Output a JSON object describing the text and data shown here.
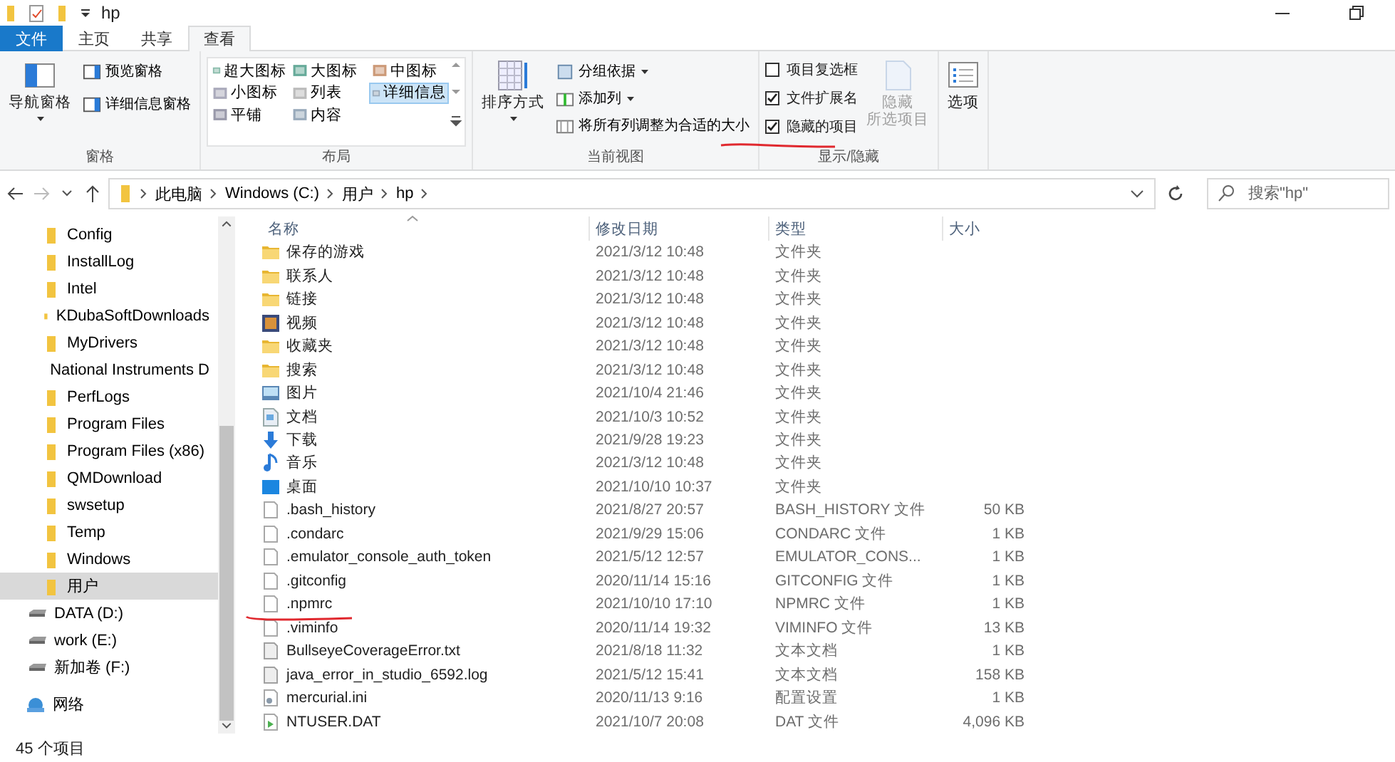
{
  "window": {
    "title": "hp"
  },
  "ribbon_tabs": [
    {
      "label": "文件",
      "kind": "file"
    },
    {
      "label": "主页",
      "kind": "tab",
      "selected": false
    },
    {
      "label": "共享",
      "kind": "tab",
      "selected": false
    },
    {
      "label": "查看",
      "kind": "tab",
      "selected": true
    }
  ],
  "ribbon": {
    "panes": {
      "label": "窗格",
      "navigation_pane": "导航窗格",
      "preview_pane": "预览窗格",
      "details_pane": "详细信息窗格"
    },
    "layout": {
      "label": "布局",
      "options": [
        {
          "label": "超大图标",
          "selected": false
        },
        {
          "label": "大图标",
          "selected": false
        },
        {
          "label": "中图标",
          "selected": false
        },
        {
          "label": "小图标",
          "selected": false
        },
        {
          "label": "列表",
          "selected": false
        },
        {
          "label": "详细信息",
          "selected": true
        },
        {
          "label": "平铺",
          "selected": false
        },
        {
          "label": "内容",
          "selected": false
        }
      ]
    },
    "current_view": {
      "label": "当前视图",
      "sort_by": "排序方式",
      "group_by": "分组依据",
      "add_column": "添加列",
      "fit_columns": "将所有列调整为合适的大小"
    },
    "show_hide": {
      "label": "显示/隐藏",
      "checkboxes": [
        {
          "label": "项目复选框",
          "checked": false
        },
        {
          "label": "文件扩展名",
          "checked": true
        },
        {
          "label": "隐藏的项目",
          "checked": true
        }
      ],
      "hide_selected": {
        "lines": [
          "隐藏",
          "所选项目"
        ],
        "disabled": true
      }
    },
    "options": "选项"
  },
  "address": {
    "path": [
      "此电脑",
      "Windows (C:)",
      "用户",
      "hp"
    ],
    "search_placeholder": "搜索\"hp\""
  },
  "sidebar": {
    "items": [
      {
        "label": "Config",
        "kind": "folder",
        "selected": false
      },
      {
        "label": "InstallLog",
        "kind": "folder",
        "selected": false
      },
      {
        "label": "Intel",
        "kind": "folder",
        "selected": false
      },
      {
        "label": "KDubaSoftDownloads",
        "kind": "folder",
        "selected": false
      },
      {
        "label": "MyDrivers",
        "kind": "folder",
        "selected": false
      },
      {
        "label": "National Instruments D",
        "kind": "folder",
        "selected": false
      },
      {
        "label": "PerfLogs",
        "kind": "folder",
        "selected": false
      },
      {
        "label": "Program Files",
        "kind": "folder",
        "selected": false
      },
      {
        "label": "Program Files (x86)",
        "kind": "folder",
        "selected": false
      },
      {
        "label": "QMDownload",
        "kind": "folder",
        "selected": false
      },
      {
        "label": "swsetup",
        "kind": "folder",
        "selected": false
      },
      {
        "label": "Temp",
        "kind": "folder",
        "selected": false
      },
      {
        "label": "Windows",
        "kind": "folder",
        "selected": false
      },
      {
        "label": "用户",
        "kind": "folder",
        "selected": true
      },
      {
        "label": "DATA (D:)",
        "kind": "drive",
        "selected": false
      },
      {
        "label": "work (E:)",
        "kind": "drive",
        "selected": false
      },
      {
        "label": "新加卷 (F:)",
        "kind": "drive",
        "selected": false
      },
      {
        "label": "网络",
        "kind": "network",
        "selected": false
      }
    ]
  },
  "table": {
    "columns": [
      "名称",
      "修改日期",
      "类型",
      "大小"
    ],
    "rows": [
      {
        "name": "保存的游戏",
        "date": "2021/3/12 10:48",
        "type": "文件夹",
        "kind": "folder"
      },
      {
        "name": "联系人",
        "date": "2021/3/12 10:48",
        "type": "文件夹",
        "kind": "folder"
      },
      {
        "name": "链接",
        "date": "2021/3/12 10:48",
        "type": "文件夹",
        "kind": "folder"
      },
      {
        "name": "视频",
        "date": "2021/3/12 10:48",
        "type": "文件夹",
        "kind": "video"
      },
      {
        "name": "收藏夹",
        "date": "2021/3/12 10:48",
        "type": "文件夹",
        "kind": "folder"
      },
      {
        "name": "搜索",
        "date": "2021/3/12 10:48",
        "type": "文件夹",
        "kind": "folder"
      },
      {
        "name": "图片",
        "date": "2021/10/4 21:46",
        "type": "文件夹",
        "kind": "image"
      },
      {
        "name": "文档",
        "date": "2021/10/3 10:52",
        "type": "文件夹",
        "kind": "document"
      },
      {
        "name": "下载",
        "date": "2021/9/28 19:23",
        "type": "文件夹",
        "kind": "download"
      },
      {
        "name": "音乐",
        "date": "2021/3/12 10:48",
        "type": "文件夹",
        "kind": "music"
      },
      {
        "name": "桌面",
        "date": "2021/10/10 10:37",
        "type": "文件夹",
        "kind": "desktop"
      },
      {
        "name": ".bash_history",
        "date": "2021/8/27 20:57",
        "type": "BASH_HISTORY 文件",
        "size": "50 KB",
        "kind": "file"
      },
      {
        "name": ".condarc",
        "date": "2021/9/29 15:06",
        "type": "CONDARC 文件",
        "size": "1 KB",
        "kind": "file"
      },
      {
        "name": ".emulator_console_auth_token",
        "date": "2021/5/12 12:57",
        "type": "EMULATOR_CONS...",
        "size": "1 KB",
        "kind": "file"
      },
      {
        "name": ".gitconfig",
        "date": "2020/11/14 15:16",
        "type": "GITCONFIG 文件",
        "size": "1 KB",
        "kind": "file"
      },
      {
        "name": ".npmrc",
        "date": "2021/10/10 17:10",
        "type": "NPMRC 文件",
        "size": "1 KB",
        "kind": "file"
      },
      {
        "name": ".viminfo",
        "date": "2020/11/14 19:32",
        "type": "VIMINFO 文件",
        "size": "13 KB",
        "kind": "file"
      },
      {
        "name": "BullseyeCoverageError.txt",
        "date": "2021/8/18 11:32",
        "type": "文本文档",
        "size": "1 KB",
        "kind": "text"
      },
      {
        "name": "java_error_in_studio_6592.log",
        "date": "2021/5/12 15:41",
        "type": "文本文档",
        "size": "158 KB",
        "kind": "text"
      },
      {
        "name": "mercurial.ini",
        "date": "2020/11/13 9:16",
        "type": "配置设置",
        "size": "1 KB",
        "kind": "config"
      },
      {
        "name": "NTUSER.DAT",
        "date": "2021/10/7 20:08",
        "type": "DAT 文件",
        "size": "4,096 KB",
        "kind": "data"
      }
    ]
  },
  "status_bar": {
    "count": "45 个项目"
  }
}
